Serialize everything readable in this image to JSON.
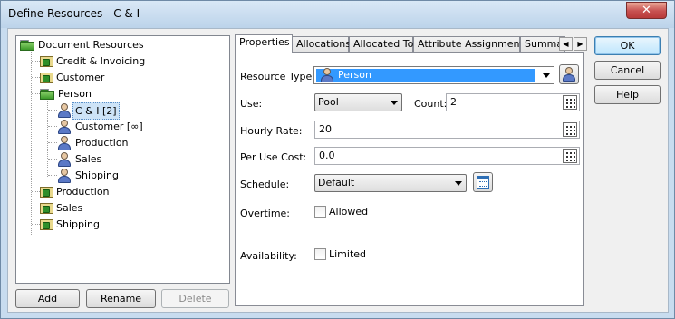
{
  "window": {
    "title": "Define Resources - C & I",
    "close_label": "✕"
  },
  "tree": {
    "items": [
      {
        "label": "Document Resources"
      },
      {
        "label": "Credit & Invoicing"
      },
      {
        "label": "Customer"
      },
      {
        "label": "Person"
      },
      {
        "label": "C & I [2]"
      },
      {
        "label": "Customer [∞]"
      },
      {
        "label": "Production"
      },
      {
        "label": "Sales"
      },
      {
        "label": "Shipping"
      },
      {
        "label": "Production"
      },
      {
        "label": "Sales"
      },
      {
        "label": "Shipping"
      }
    ]
  },
  "buttons": {
    "add": "Add",
    "rename": "Rename",
    "delete": "Delete",
    "ok": "OK",
    "cancel": "Cancel",
    "help": "Help"
  },
  "tabs": [
    "Properties",
    "Allocations",
    "Allocated To",
    "Attribute Assignments",
    "Summar"
  ],
  "form": {
    "resource_type_label": "Resource Type:",
    "resource_type_value": "Person",
    "use_label": "Use:",
    "use_value": "Pool",
    "count_label": "Count:",
    "count_value": "2",
    "hourly_rate_label": "Hourly Rate:",
    "hourly_rate_value": "20",
    "per_use_cost_label": "Per Use Cost:",
    "per_use_cost_value": "0.0",
    "schedule_label": "Schedule:",
    "schedule_value": "Default",
    "overtime_label": "Overtime:",
    "overtime_check_label": "Allowed",
    "availability_label": "Availability:",
    "availability_check_label": "Limited"
  },
  "colors": {
    "selected_blue": "#3399ff",
    "folder_green": "#3c9a2a"
  }
}
